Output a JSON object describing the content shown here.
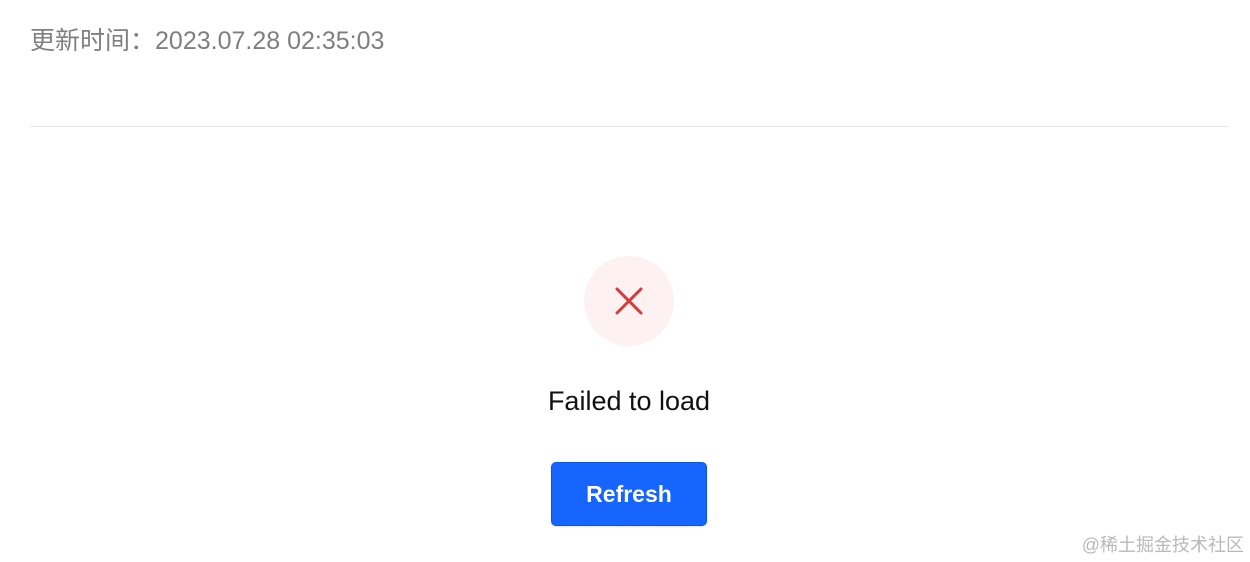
{
  "header": {
    "updated_label": "更新时间：",
    "updated_value": "2023.07.28 02:35:03"
  },
  "error": {
    "icon": "close-icon",
    "message": "Failed to load",
    "icon_color": "#d63b3b",
    "icon_background": "#fdf1f1"
  },
  "actions": {
    "refresh_label": "Refresh",
    "button_color": "#1765ff"
  },
  "watermark": {
    "text": "@稀土掘金技术社区"
  }
}
